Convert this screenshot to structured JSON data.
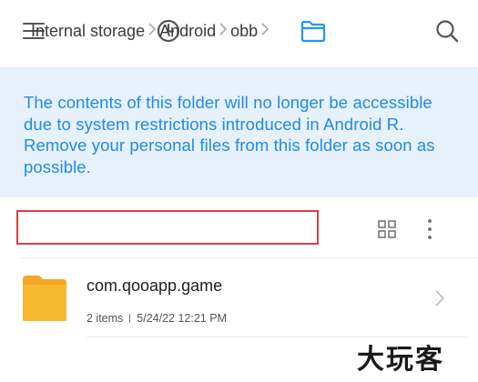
{
  "toolbar": {
    "menu_icon": "hamburger-menu-icon",
    "recent_icon": "clock-icon",
    "folder_icon": "folder-icon",
    "search_icon": "search-icon",
    "active_color": "#2196f3",
    "icon_color": "#555555"
  },
  "banner": {
    "message": "The contents of this folder will no longer be accessible due to system restrictions introduced in Android R. Remove your personal files from this folder as soon as possible.",
    "background": "#e7f1fb",
    "text_color": "#1f8be8"
  },
  "breadcrumb": {
    "items": [
      "Internal storage",
      "Android",
      "obb"
    ],
    "highlight_color": "#d94040"
  },
  "view_controls": {
    "grid_icon": "grid-view-icon",
    "more_icon": "more-vertical-icon"
  },
  "files": [
    {
      "name": "com.qooapp.game",
      "items": "2 items",
      "modified": "5/24/22 12:21 PM",
      "icon": "folder-icon",
      "icon_color": "#f7b731"
    }
  ],
  "watermark": {
    "text": "大玩客"
  }
}
